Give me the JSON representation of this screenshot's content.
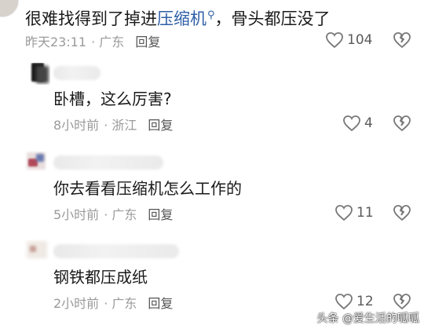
{
  "top_comment": {
    "text_before": "很难找得到了掉进",
    "keyword": "压缩机",
    "search_mark": "⁹",
    "text_after": "，骨头都压没了",
    "time": "昨天23:11",
    "location": "· 广东",
    "reply_label": "回复",
    "likes": "104"
  },
  "replies": [
    {
      "text": "卧槽，这么厉害?",
      "time": "8小时前",
      "location": "· 浙江",
      "reply_label": "回复",
      "likes": "4"
    },
    {
      "text": "你去看看压缩机怎么工作的",
      "time": "5小时前",
      "location": "· 广东",
      "reply_label": "回复",
      "likes": "11"
    },
    {
      "text": "钢铁都压成纸",
      "time": "2小时前",
      "location": "· 广东",
      "reply_label": "回复",
      "likes": "12"
    }
  ],
  "watermark": "头条 @爱生活的呱呱",
  "colors": {
    "keyword": "#2f5fa7",
    "meta": "#9a9a9a",
    "icon": "#777777"
  }
}
